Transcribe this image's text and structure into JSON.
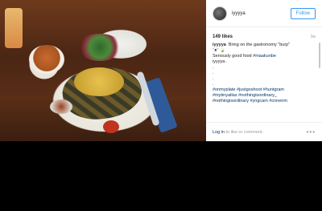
{
  "post": {
    "username": "iyyyya",
    "follow_label": "Follow",
    "likes": "149 likes",
    "age": "1w",
    "caption": {
      "line1_user": "iyyyya",
      "line1": "Bring on the gastronomy \"burp\"",
      "line2": "ᵔᴥᵔ 🍃",
      "line3_prefix": "Seriously good food ",
      "line3_tag": "#maakunbe",
      "line4": "iyyyya .",
      "dots": [
        ".",
        ".",
        ".",
        "."
      ],
      "tags1": "#onmyplate #justgoshoot #huntgram",
      "tags2": "#mytinyatlas #nothingisordinary_",
      "tags3": "#nothingisordinary #yngcam #cnnenm"
    },
    "login_link": "Log in",
    "login_text": " to like or comment.",
    "more_dots": "•••"
  },
  "icons": {
    "avatar": "avatar-icon",
    "more": "more-options-icon"
  }
}
